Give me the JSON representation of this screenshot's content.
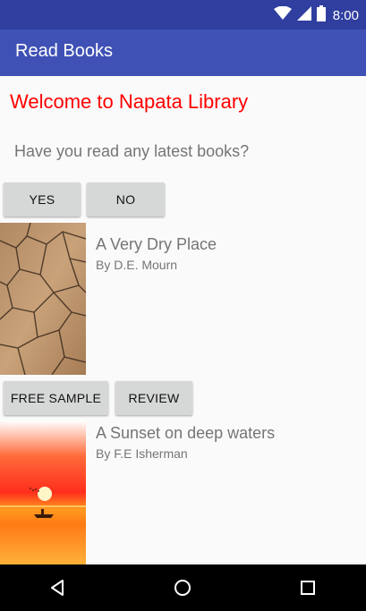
{
  "status_bar": {
    "time": "8:00",
    "icons": [
      "wifi-icon",
      "signal-icon",
      "battery-icon"
    ]
  },
  "app_bar": {
    "title": "Read Books"
  },
  "main": {
    "welcome": "Welcome to Napata Library",
    "question": "Have you read any latest books?",
    "yes_label": "YES",
    "no_label": "NO"
  },
  "books": [
    {
      "title": "A Very Dry Place",
      "author": "By D.E. Mourn"
    },
    {
      "title": "A Sunset on deep waters",
      "author": "By F.E Isherman"
    }
  ],
  "actions": {
    "free_sample_label": "FREE SAMPLE",
    "review_label": "REVIEW"
  },
  "nav_bar": {
    "icons": [
      "back-icon",
      "home-icon",
      "recents-icon"
    ]
  },
  "colors": {
    "primary": "#3f51b5",
    "primary_dark": "#303f9f",
    "welcome_text": "#ff0000"
  }
}
